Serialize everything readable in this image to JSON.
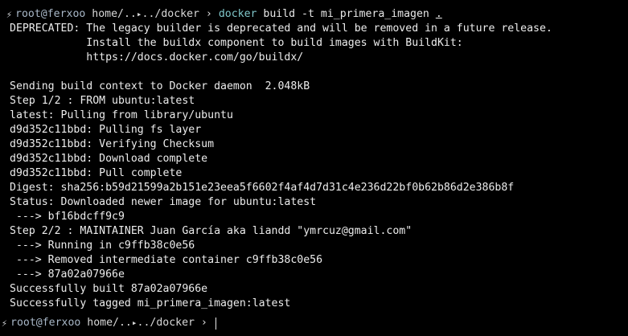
{
  "colors": {
    "background": "#000000",
    "text": "#ececec",
    "command": "#7fc6c9"
  },
  "prompt": {
    "user_host": "root@ferxoo",
    "path_start": "home/..",
    "path_folder_glyph": "▸",
    "path_end": "../docker",
    "arrow": "›"
  },
  "command": {
    "name": "docker",
    "args": "build -t mi_primera_imagen",
    "context": "."
  },
  "output_lines": [
    "DEPRECATED: The legacy builder is deprecated and will be removed in a future release.",
    "            Install the buildx component to build images with BuildKit:",
    "            https://docs.docker.com/go/buildx/",
    "",
    "Sending build context to Docker daemon  2.048kB",
    "Step 1/2 : FROM ubuntu:latest",
    "latest: Pulling from library/ubuntu",
    "d9d352c11bbd: Pulling fs layer",
    "d9d352c11bbd: Verifying Checksum",
    "d9d352c11bbd: Download complete",
    "d9d352c11bbd: Pull complete",
    "Digest: sha256:b59d21599a2b151e23eea5f6602f4af4d7d31c4e236d22bf0b62b86d2e386b8f",
    "Status: Downloaded newer image for ubuntu:latest",
    " ---> bf16bdcff9c9",
    "Step 2/2 : MAINTAINER Juan García aka liandd \"ymrcuz@gmail.com\"",
    " ---> Running in c9ffb38c0e56",
    " ---> Removed intermediate container c9ffb38c0e56",
    " ---> 87a02a07966e",
    "Successfully built 87a02a07966e",
    "Successfully tagged mi_primera_imagen:latest"
  ]
}
